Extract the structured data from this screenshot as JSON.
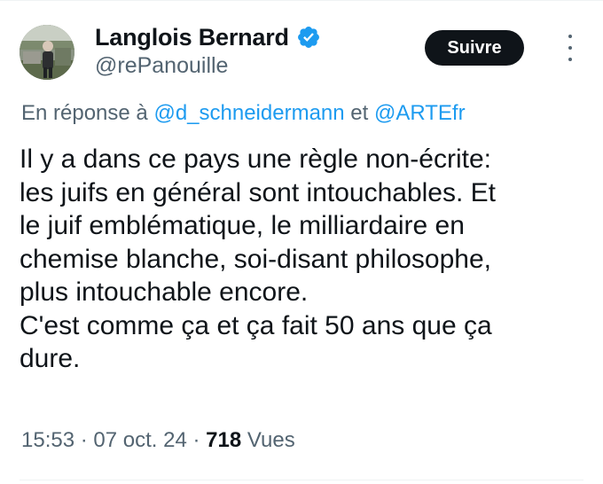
{
  "author": {
    "display_name": "Langlois Bernard",
    "handle": "@rePanouille",
    "verified": true,
    "avatar_icon": "profile-photo"
  },
  "follow_button": {
    "label": "Suivre"
  },
  "more_icon": "more-vertical-icon",
  "reply": {
    "prefix": "En réponse à",
    "mention_1": "@d_schneidermann",
    "conjunction": "et",
    "mention_2": "@ARTEfr"
  },
  "tweet": {
    "lines": [
      "Il y a dans ce pays une règle non-écrite:",
      "les juifs en général sont intouchables. Et",
      "le juif emblématique, le milliardaire en",
      "chemise blanche, soi-disant philosophe,",
      "plus intouchable encore.",
      "C'est comme ça et ça fait 50 ans que ça",
      "dure."
    ]
  },
  "meta": {
    "time": "15:53",
    "separator": "·",
    "date": "07 oct. 24",
    "views_count": "718",
    "views_label": "Vues"
  },
  "colors": {
    "text": "#0f1419",
    "secondary": "#536471",
    "link": "#1d9bf0",
    "verified": "#1d9bf0",
    "button_bg": "#0f1419",
    "button_text": "#ffffff"
  }
}
